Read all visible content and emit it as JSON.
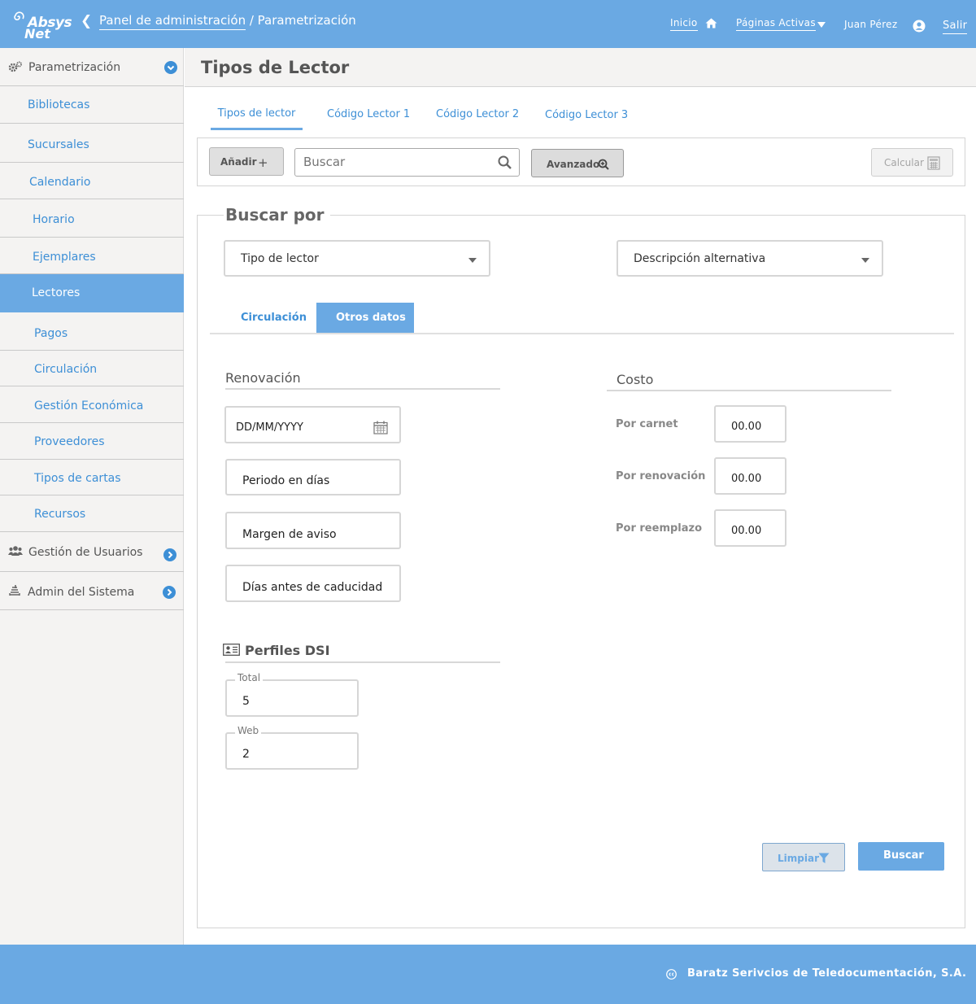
{
  "header": {
    "logo_line1": "Absys",
    "logo_line2": "Net",
    "breadcrumb_link": "Panel de administración",
    "breadcrumb_current": " / Parametrización",
    "home_label": "Inicio",
    "active_pages_label": "Páginas Activas",
    "user_name": "Juan Pérez",
    "logout_label": "Salir"
  },
  "sidebar": {
    "section_param": "Parametrización",
    "items": [
      {
        "label": "Bibliotecas"
      },
      {
        "label": "Sucursales"
      },
      {
        "label": "Calendario"
      },
      {
        "label": "Horario"
      },
      {
        "label": "Ejemplares"
      },
      {
        "label": "Lectores"
      },
      {
        "label": "Pagos"
      },
      {
        "label": "Circulación"
      },
      {
        "label": "Gestión Económica"
      },
      {
        "label": "Proveedores"
      },
      {
        "label": "Tipos de cartas"
      },
      {
        "label": "Recursos"
      }
    ],
    "section_users": "Gestión de Usuarios",
    "section_admin": "Admin del Sistema"
  },
  "main": {
    "title": "Tipos de Lector",
    "tabs": [
      {
        "label": "Tipos de lector"
      },
      {
        "label": "Código Lector 1"
      },
      {
        "label": "Código Lector 2"
      },
      {
        "label": "Código Lector 3"
      }
    ],
    "toolbar": {
      "add_label": "Añadir",
      "search_placeholder": "Buscar",
      "advanced_label": "Avanzado",
      "calc_label": "Calcular"
    },
    "search_panel": {
      "legend": "Buscar por",
      "select_type": "Tipo de lector",
      "select_desc": "Descripción alternativa",
      "subtabs": [
        {
          "label": "Circulación"
        },
        {
          "label": "Otros datos"
        }
      ],
      "renewal": {
        "title": "Renovación",
        "date_placeholder": "DD/MM/YYYY",
        "period_placeholder": "Periodo en días",
        "margin_placeholder": "Margen de aviso",
        "days_placeholder": "Días antes de caducidad"
      },
      "cost": {
        "title": "Costo",
        "rows": [
          {
            "label": "Por carnet",
            "value": "00.00"
          },
          {
            "label": "Por renovación",
            "value": "00.00"
          },
          {
            "label": "Por reemplazo",
            "value": "00.00"
          }
        ]
      },
      "dsi": {
        "title": "Perfiles DSI",
        "total_label": "Total",
        "total_value": "5",
        "web_label": "Web",
        "web_value": "2"
      },
      "clear_label": "Limpiar",
      "search_label": "Buscar"
    }
  },
  "footer": {
    "text": "Baratz Serivcios de Teledocumentación, S.A."
  },
  "colors": {
    "primary": "#6aa9e3",
    "link": "#3d8fd6",
    "sidebar_bg": "#f4f3f2"
  }
}
